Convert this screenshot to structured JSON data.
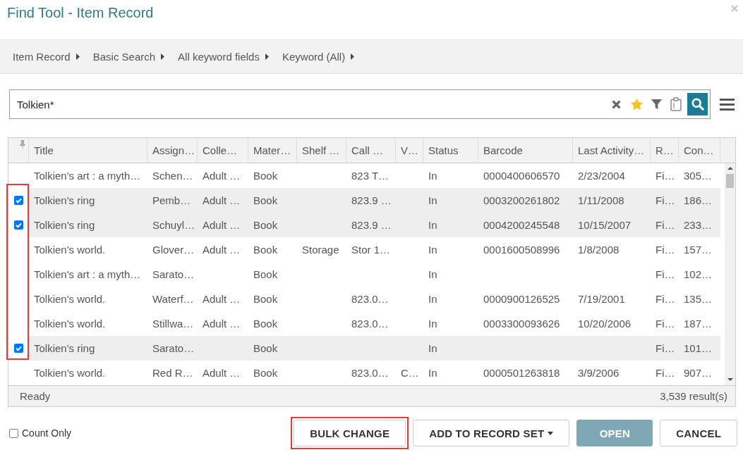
{
  "window": {
    "title": "Find Tool - Item Record"
  },
  "breadcrumbs": [
    "Item Record",
    "Basic Search",
    "All keyword fields",
    "Keyword (All)"
  ],
  "search": {
    "value": "Tolkien*"
  },
  "table": {
    "columns": [
      "Title",
      "Assign…",
      "Colle…",
      "Mater…",
      "Shelf …",
      "Call …",
      "V…",
      "Status",
      "Barcode",
      "Last Activity…",
      "R…",
      "Con…"
    ],
    "rows": [
      {
        "selected": false,
        "cells": [
          "Tolkien's art : a myth…",
          "Schen…",
          "Adult …",
          "Book",
          null,
          "823 T…",
          null,
          "In",
          "0000400606570",
          "2/23/2004",
          "Fi…",
          "305…"
        ]
      },
      {
        "selected": true,
        "cells": [
          "Tolkien's ring",
          "Pemb…",
          "Adult …",
          "Book",
          null,
          "823.9 …",
          null,
          "In",
          "0003200261802",
          "1/11/2008",
          "Fi…",
          "186…"
        ]
      },
      {
        "selected": true,
        "cells": [
          "Tolkien's ring",
          "Schuyl…",
          "Adult …",
          "Book",
          null,
          "823.9 …",
          null,
          "In",
          "0004200245548",
          "10/15/2007",
          "Fi…",
          "233…"
        ]
      },
      {
        "selected": false,
        "cells": [
          "Tolkien's world.",
          "Glover…",
          "Adult …",
          "Book",
          "Storage",
          "Stor 1…",
          null,
          "In",
          "0001600508996",
          "1/8/2008",
          "Fi…",
          "157…"
        ]
      },
      {
        "selected": false,
        "cells": [
          "Tolkien's art : a myth…",
          "Sarato…",
          null,
          "Book",
          null,
          null,
          null,
          "In",
          null,
          null,
          "Fi…",
          "102…"
        ]
      },
      {
        "selected": false,
        "cells": [
          "Tolkien's world.",
          "Waterf…",
          "Adult …",
          "Book",
          null,
          "823.0…",
          null,
          "In",
          "0000900126525",
          "7/19/2001",
          "Fi…",
          "135…"
        ]
      },
      {
        "selected": false,
        "cells": [
          "Tolkien's world.",
          "Stillwa…",
          "Adult …",
          "Book",
          null,
          "823.0…",
          null,
          "In",
          "0003300093626",
          "10/20/2006",
          "Fi…",
          "187…"
        ]
      },
      {
        "selected": true,
        "cells": [
          "Tolkien's ring",
          "Sarato…",
          null,
          "Book",
          null,
          null,
          null,
          "In",
          null,
          null,
          "Fi…",
          "101…"
        ]
      },
      {
        "selected": false,
        "cells": [
          "Tolkien's world.",
          "Red R…",
          "Adult …",
          "Book",
          null,
          "823.0…",
          "C…",
          "In",
          "0000501263818",
          "3/9/2006",
          "Fi…",
          "907…"
        ]
      }
    ],
    "selection_outlined": true,
    "status": "Ready",
    "result_count": "3,539 result(s)"
  },
  "count_only": {
    "label": "Count Only",
    "checked": false
  },
  "buttons": [
    {
      "label": "BULK CHANGE",
      "kind": "default",
      "highlighted": true
    },
    {
      "label": "ADD TO RECORD SET",
      "kind": "dropdown",
      "highlighted": false
    },
    {
      "label": "OPEN",
      "kind": "primary",
      "highlighted": false
    },
    {
      "label": "CANCEL",
      "kind": "default",
      "highlighted": false
    }
  ]
}
